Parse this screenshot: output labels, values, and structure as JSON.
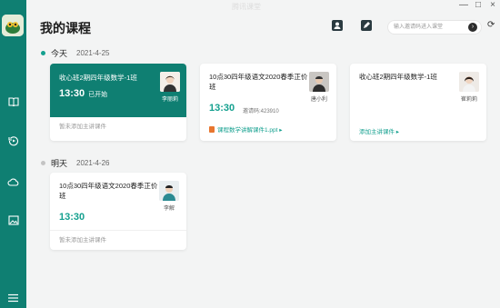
{
  "window": {
    "title": "腾讯课堂",
    "controls": [
      "—",
      "□",
      "×"
    ]
  },
  "sidebar": {
    "icons": [
      "book-icon",
      "playback-icon",
      "cloud-icon",
      "picture-icon",
      "menu-icon"
    ]
  },
  "header": {
    "title": "我的课程",
    "search_placeholder": "输入邀请码进入课堂"
  },
  "days": [
    {
      "label": "今天",
      "date": "2021-4-25",
      "dot_color": "#14a08f"
    },
    {
      "label": "明天",
      "date": "2021-4-26",
      "dot_color": "#c4c4c4"
    }
  ],
  "courses": [
    {
      "title": "收心班2期四年级数学-1班",
      "time": "13:30",
      "status": "已开始",
      "teacher": "李丽莉",
      "footer": "暂未添加主讲课件"
    },
    {
      "title": "10点30四年级语文2020春季正价班",
      "time": "13:30",
      "code": "邀请码:423910",
      "teacher": "唐小利",
      "file": "课程数学讲解课件1.ppt"
    },
    {
      "title": "收心班2期四年级数学-1班",
      "teacher": "崔莉莉",
      "link": "添加主讲课件"
    },
    {
      "title": "10点30四年级语文2020春季正价班",
      "time": "13:30",
      "teacher": "李解",
      "footer": "暂未添加主讲课件"
    }
  ],
  "colors": {
    "accent": "#14a08f",
    "sidebar": "#0f7f72"
  }
}
